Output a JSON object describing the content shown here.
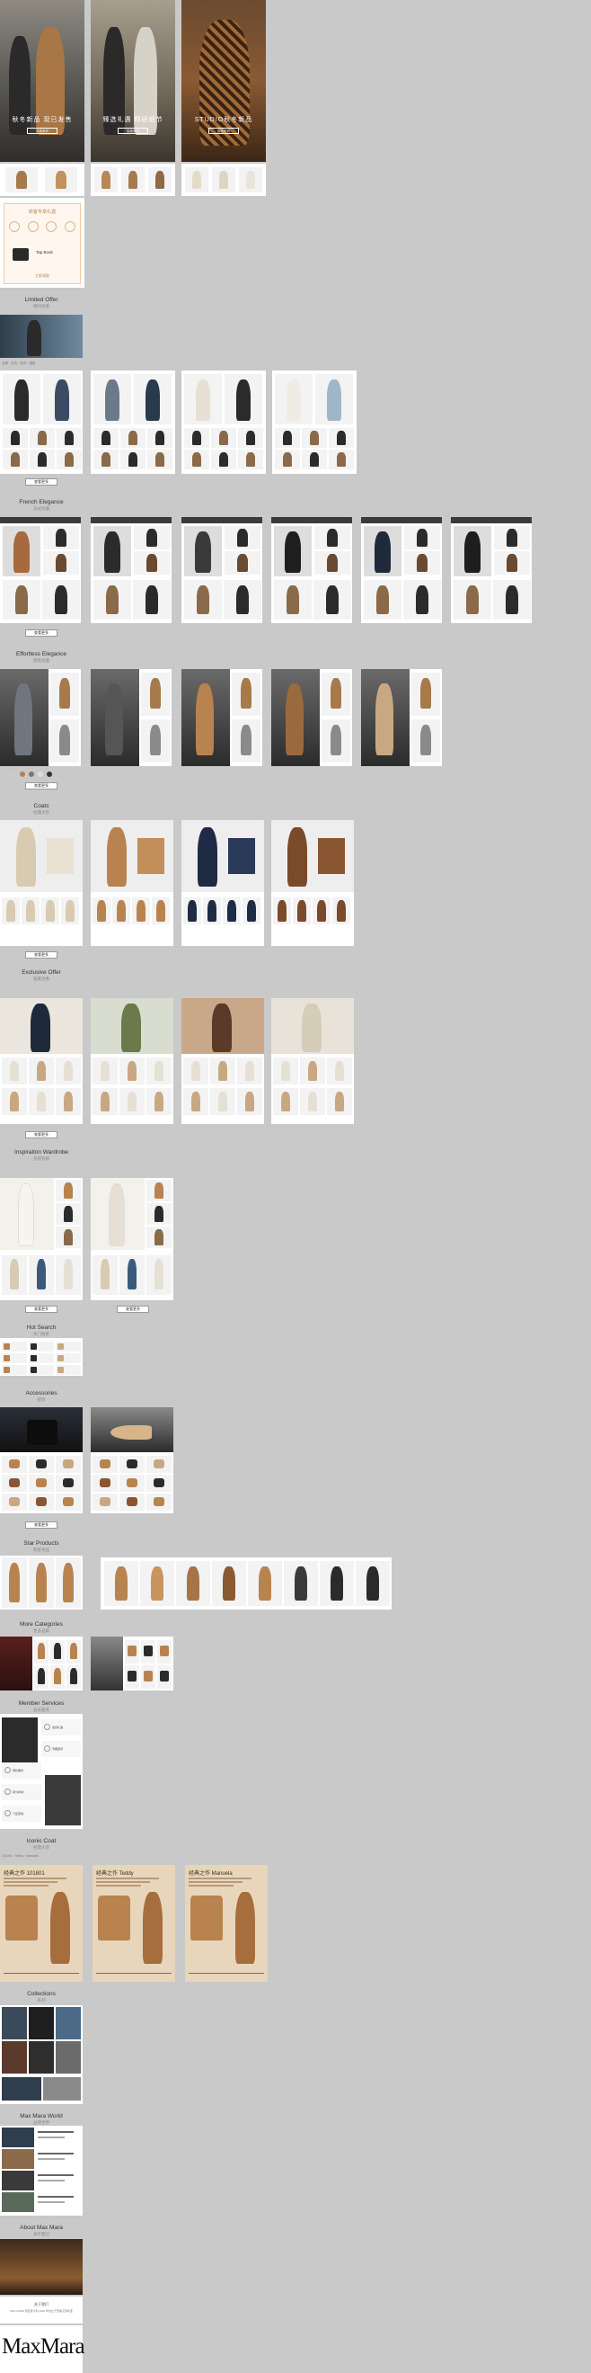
{
  "colors": {
    "page_bg": "#c9c9c9",
    "panel_bg": "#ffffff",
    "camel": "#b8834f",
    "dark": "#2b2b2b"
  },
  "hero": [
    {
      "title": "秋冬新品 现已发售",
      "button": "探索系列"
    },
    {
      "title": "臻选礼遇 精研细节",
      "button": "探索系列"
    },
    {
      "title": "STUDIO秋冬新品",
      "button": "探索系列"
    }
  ],
  "promo": {
    "title": "新客专享礼遇",
    "subtitle": "Tap Book",
    "footer": "立即领取"
  },
  "sections": {
    "limited": {
      "title": "Limited Offer",
      "sub": "限时优惠"
    },
    "french": {
      "title": "French Elegance",
      "sub": "法式优雅"
    },
    "effortless": {
      "title": "Effortless Elegance",
      "sub": "随性优雅"
    },
    "coats": {
      "title": "Coats",
      "sub": "经典大衣"
    },
    "exclusive": {
      "title": "Exclusive Offer",
      "sub": "独家优惠"
    },
    "inspiration": {
      "title": "Inspiration Wardrobe",
      "sub": "灵感衣橱"
    },
    "hot": {
      "title": "Hot Search",
      "sub": "热门搜索"
    },
    "accessories": {
      "title": "Accessories",
      "sub": "配饰"
    },
    "star": {
      "title": "Star Products",
      "sub": "明星单品"
    },
    "more": {
      "title": "More Categories",
      "sub": "更多品类"
    },
    "member": {
      "title": "Member Services",
      "sub": "会员服务"
    },
    "iconic": {
      "title": "Iconic Coat",
      "sub": "经典大衣"
    },
    "collections": {
      "title": "Collections",
      "sub": "系列"
    },
    "maxmaraworld": {
      "title": "Max Mara World",
      "sub": "品牌世界"
    },
    "about": {
      "title": "About Max Mara",
      "sub": "关于我们"
    }
  },
  "buttons": {
    "more": "查看更多"
  },
  "iconic_cards": [
    {
      "title": "经典之作 101801"
    },
    {
      "title": "经典之作 Teddy"
    },
    {
      "title": "经典之作 Manuela"
    }
  ],
  "member_items": [
    "会员礼遇",
    "专属顾问",
    "预约服务",
    "积分商城",
    "门店查询"
  ],
  "about": {
    "line1": "关于我们",
    "line2": "MAX MARA 源自意大利 1951 年创立于雷焦艾米利亚"
  },
  "brand": "MaxMara"
}
